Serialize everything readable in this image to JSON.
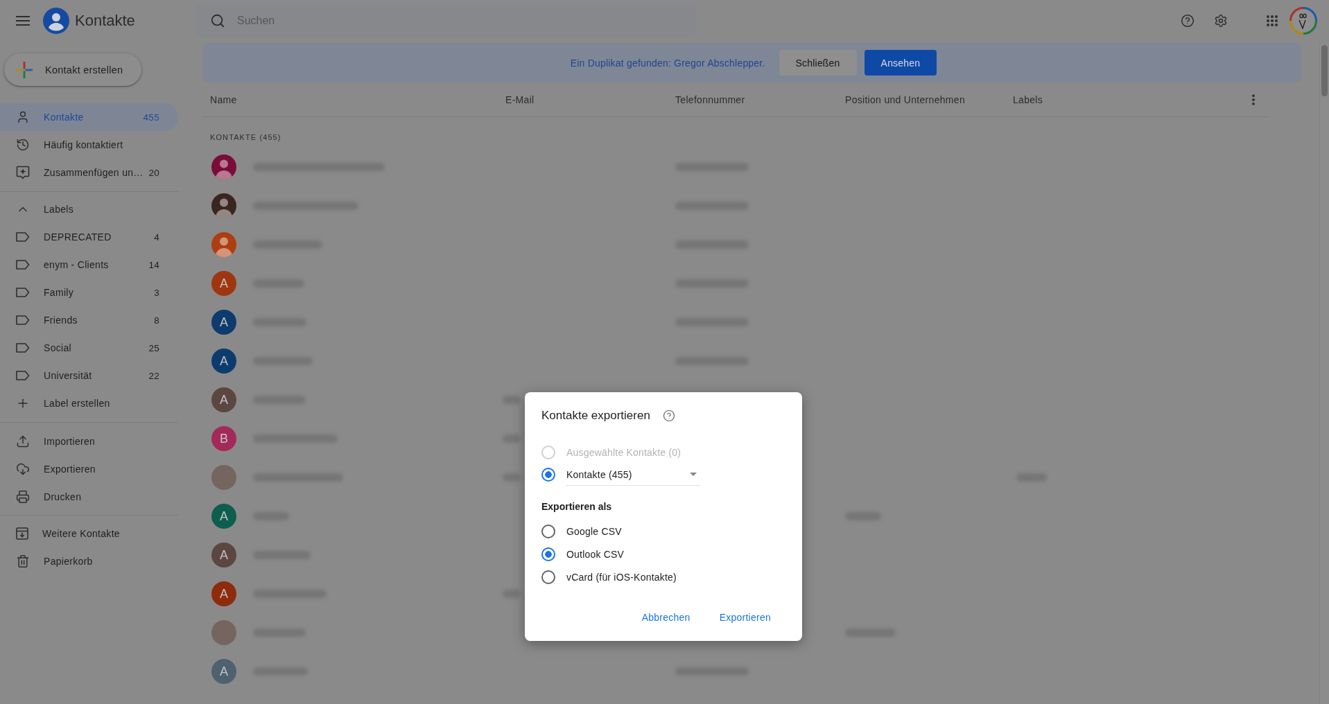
{
  "app_bar": {
    "title": "Kontakte",
    "search": {
      "placeholder": "Suchen"
    }
  },
  "sidebar": {
    "create_button": "Kontakt erstellen",
    "nav": [
      {
        "label": "Kontakte",
        "count": "455",
        "selected": true
      },
      {
        "label": "Häufig kontaktiert",
        "selected": false
      },
      {
        "label": "Zusammenfügen un…",
        "count": "20",
        "selected": false
      }
    ],
    "labels": {
      "title": "Labels",
      "expanded": true,
      "items": [
        {
          "label": "DEPRECATED",
          "count": "4",
          "selected": false
        },
        {
          "label": "enym - Clients",
          "count": "14",
          "selected": false
        },
        {
          "label": "Family",
          "count": "3",
          "selected": false
        },
        {
          "label": "Friends",
          "count": "8",
          "selected": false
        },
        {
          "label": "Social",
          "count": "25",
          "selected": false
        },
        {
          "label": "Universität",
          "count": "22",
          "selected": false
        }
      ],
      "create": "Label erstellen"
    },
    "tools": [
      "Importieren",
      "Exportieren",
      "Drucken"
    ],
    "more": [
      {
        "label": "Weitere Kontakte",
        "selected": false
      },
      {
        "label": "Papierkorb",
        "selected": false
      }
    ]
  },
  "notice": {
    "text": "Ein Duplikat gefunden: Gregor Abschlepper.",
    "buttons": [
      {
        "label": "Schließen",
        "kind": "secondary"
      },
      {
        "label": "Ansehen",
        "kind": "primary"
      }
    ]
  },
  "table": {
    "columns": [
      "Name",
      "E-Mail",
      "Telefonnummer",
      "Position und Unternehmen",
      "Labels"
    ],
    "section_title": "KONTAKTE (455)",
    "rows": [
      {
        "avatar": {
          "kind": "person",
          "color": "#7b0c3a"
        },
        "blurred_cells": [
          true,
          false,
          true,
          false,
          false
        ]
      },
      {
        "avatar": {
          "kind": "person",
          "color": "#3b2521"
        },
        "blurred_cells": [
          true,
          false,
          true,
          false,
          false
        ]
      },
      {
        "avatar": {
          "kind": "person",
          "color": "#ad3e10"
        },
        "blurred_cells": [
          true,
          false,
          true,
          false,
          false
        ]
      },
      {
        "avatar": {
          "kind": "letter",
          "initial": "A",
          "color": "#a0360f"
        },
        "blurred_cells": [
          true,
          false,
          true,
          false,
          false
        ]
      },
      {
        "avatar": {
          "kind": "letter",
          "initial": "A",
          "color": "#0d3b6e"
        },
        "blurred_cells": [
          true,
          false,
          true,
          false,
          false
        ]
      },
      {
        "avatar": {
          "kind": "letter",
          "initial": "A",
          "color": "#0d3b6e"
        },
        "blurred_cells": [
          true,
          false,
          true,
          false,
          false
        ]
      },
      {
        "avatar": {
          "kind": "letter",
          "initial": "A",
          "color": "#5b4640"
        },
        "blurred_cells": [
          true,
          true,
          false,
          false,
          false
        ]
      },
      {
        "avatar": {
          "kind": "letter",
          "initial": "B",
          "color": "#a3295b"
        },
        "blurred_cells": [
          true,
          true,
          false,
          false,
          false
        ]
      },
      {
        "avatar": {
          "kind": "photo"
        },
        "blurred_cells": [
          true,
          true,
          false,
          false,
          true
        ]
      },
      {
        "avatar": {
          "kind": "letter",
          "initial": "A",
          "color": "#0e5e4e"
        },
        "blurred_cells": [
          true,
          false,
          false,
          true,
          false
        ]
      },
      {
        "avatar": {
          "kind": "letter",
          "initial": "A",
          "color": "#5b4640"
        },
        "blurred_cells": [
          true,
          false,
          false,
          false,
          false
        ]
      },
      {
        "avatar": {
          "kind": "letter",
          "initial": "A",
          "color": "#8e2b0c"
        },
        "blurred_cells": [
          true,
          true,
          false,
          false,
          false
        ]
      },
      {
        "avatar": {
          "kind": "photo"
        },
        "blurred_cells": [
          true,
          false,
          false,
          true,
          false
        ]
      },
      {
        "avatar": {
          "kind": "letter",
          "initial": "A",
          "color": "#4f6170"
        },
        "blurred_cells": [
          true,
          false,
          true,
          false,
          false
        ]
      }
    ]
  },
  "dialog": {
    "title": "Kontakte exportieren",
    "scope_options": [
      {
        "label": "Ausgewählte Kontakte (0)",
        "kind": "plain",
        "selected": false,
        "disabled": true
      },
      {
        "label": "Kontakte (455)",
        "kind": "dropdown",
        "selected": true,
        "disabled": false
      }
    ],
    "format_heading": "Exportieren als",
    "format_options": [
      {
        "label": "Google CSV",
        "selected": false
      },
      {
        "label": "Outlook CSV",
        "selected": true
      },
      {
        "label": "vCard (für iOS-Kontakte)",
        "selected": false
      }
    ],
    "buttons": [
      "Abbrechen",
      "Exportieren"
    ]
  }
}
